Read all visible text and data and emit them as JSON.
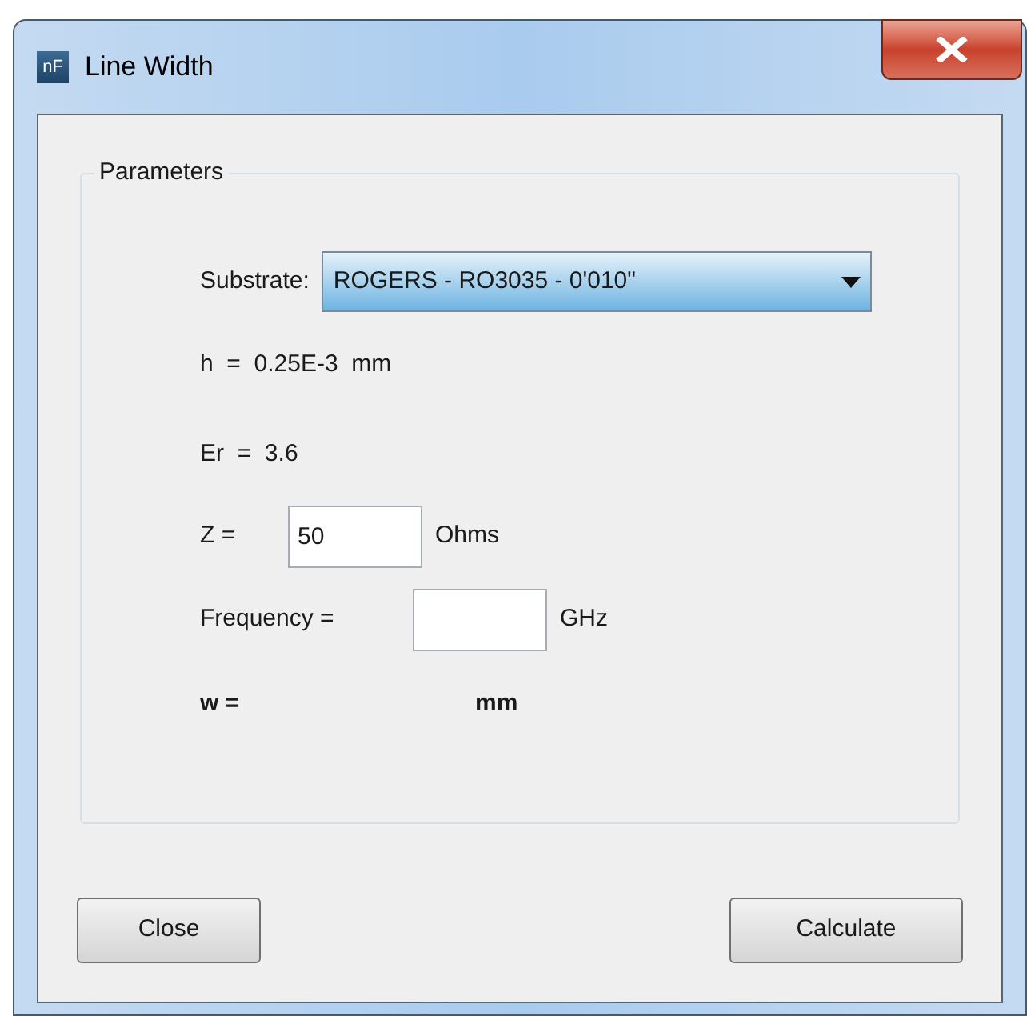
{
  "window": {
    "title": "Line Width",
    "app_icon": "nF"
  },
  "group": {
    "title": "Parameters"
  },
  "substrate": {
    "label": "Substrate:",
    "value": "ROGERS - RO3035 - 0'010\""
  },
  "h": {
    "label": "h  =  0.25E-3  mm"
  },
  "er": {
    "label": "Er  =  3.6"
  },
  "z": {
    "label": "Z =",
    "value": "50",
    "unit": "Ohms"
  },
  "frequency": {
    "label": "Frequency =",
    "unit": "GHz"
  },
  "result": {
    "label": "w =",
    "unit": "mm"
  },
  "buttons": [
    {
      "label": "Close"
    },
    {
      "label": "Calculate"
    }
  ]
}
